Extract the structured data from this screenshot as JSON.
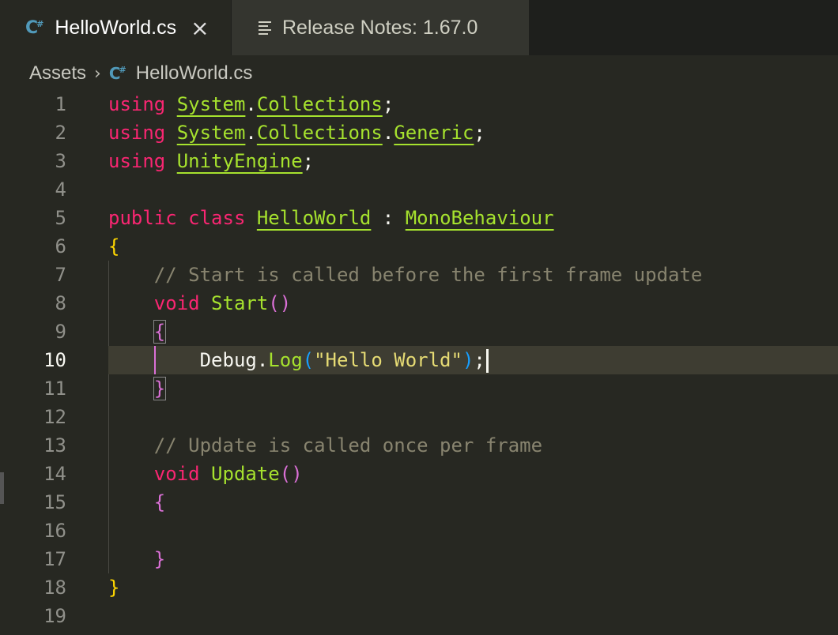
{
  "tabs": [
    {
      "label": "HelloWorld.cs",
      "icon": "csharp-file-icon",
      "active": true
    },
    {
      "label": "Release Notes: 1.67.0",
      "icon": "release-notes-icon",
      "active": false
    }
  ],
  "breadcrumb": {
    "folder": "Assets",
    "file": "HelloWorld.cs"
  },
  "icons": {
    "csharp": "C",
    "csharp_sup": "#",
    "close": "×",
    "chevron": "›"
  },
  "editor": {
    "current_line": 10,
    "lines": [
      {
        "n": "1"
      },
      {
        "n": "2"
      },
      {
        "n": "3"
      },
      {
        "n": "4"
      },
      {
        "n": "5"
      },
      {
        "n": "6"
      },
      {
        "n": "7"
      },
      {
        "n": "8"
      },
      {
        "n": "9"
      },
      {
        "n": "10"
      },
      {
        "n": "11"
      },
      {
        "n": "12"
      },
      {
        "n": "13"
      },
      {
        "n": "14"
      },
      {
        "n": "15"
      },
      {
        "n": "16"
      },
      {
        "n": "17"
      },
      {
        "n": "18"
      },
      {
        "n": "19"
      }
    ],
    "tokens": {
      "using": "using",
      "system": "System",
      "collections": "Collections",
      "generic": "Generic",
      "unityengine": "UnityEngine",
      "public": "public",
      "class": "class",
      "helloworld": "HelloWorld",
      "colon": " : ",
      "monobehaviour": "MonoBehaviour",
      "comment_start": "// Start is called before the first frame update",
      "void": "void",
      "start": "Start",
      "debug": "Debug",
      "log": "Log",
      "hello_string": "\"Hello World\"",
      "comment_update": "// Update is called once per frame",
      "update": "Update"
    }
  },
  "colors": {
    "background": "#272822",
    "keyword": "#f92672",
    "type": "#a6e22e",
    "comment": "#88846f",
    "string": "#e6db74"
  }
}
